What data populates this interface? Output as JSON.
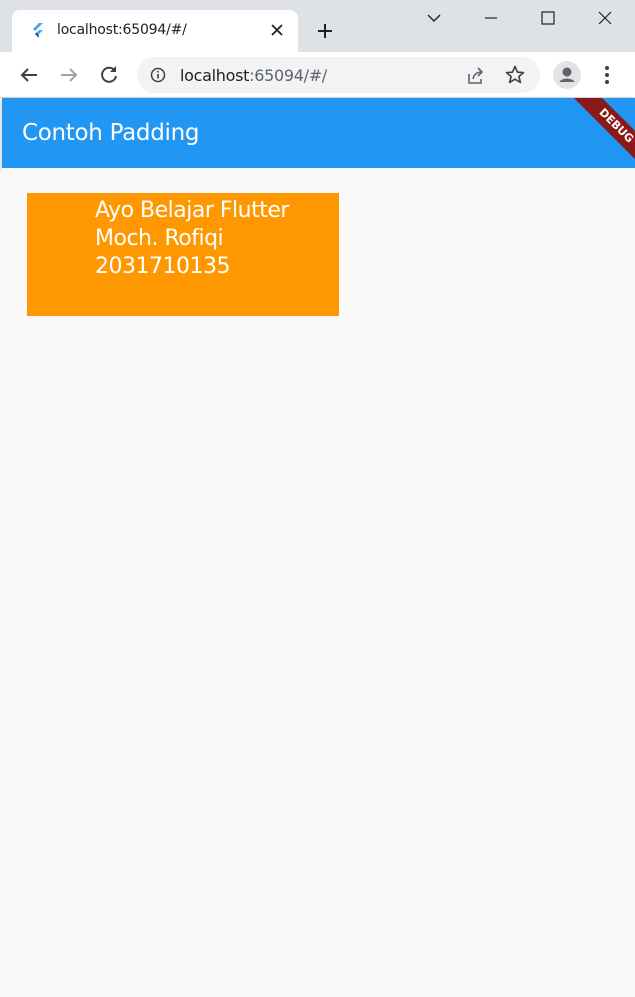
{
  "browser": {
    "tab_title": "localhost:65094/#/",
    "url_host": "localhost",
    "url_path": ":65094/#/"
  },
  "app": {
    "title": "Contoh Padding",
    "debug_label": "DEBUG",
    "box_lines": [
      "Ayo Belajar Flutter",
      "Moch. Rofiqi",
      "2031710135"
    ]
  },
  "colors": {
    "appbar": "#2196f3",
    "box": "#ff9800",
    "debug_ribbon": "#8a1a1a"
  },
  "icons": [
    "flutter-favicon-icon",
    "close-icon",
    "plus-icon",
    "chevron-down-icon",
    "minimize-icon",
    "maximize-icon",
    "close-window-icon",
    "back-arrow-icon",
    "forward-arrow-icon",
    "reload-icon",
    "info-icon",
    "share-icon",
    "star-icon",
    "profile-icon",
    "more-vert-icon"
  ]
}
